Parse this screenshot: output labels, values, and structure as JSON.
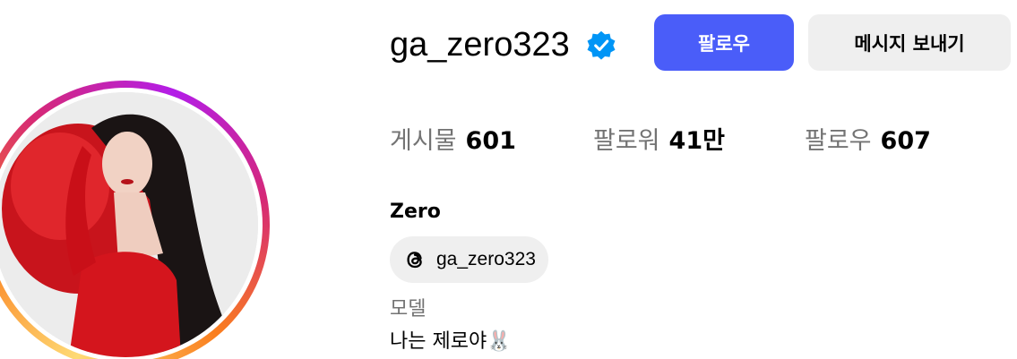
{
  "profile": {
    "username": "ga_zero323",
    "verified": true,
    "full_name": "Zero",
    "category": "모델",
    "bio": "나는 제로야🐰",
    "threads_handle": "ga_zero323"
  },
  "actions": {
    "follow_label": "팔로우",
    "message_label": "메시지 보내기"
  },
  "stats": {
    "posts_label": "게시물",
    "posts_value": "601",
    "followers_label": "팔로워",
    "followers_value": "41만",
    "following_label": "팔로우",
    "following_value": "607"
  },
  "colors": {
    "follow_button": "#4a5df9",
    "message_button": "#efefef",
    "verified_badge": "#0095f6",
    "muted_text": "#737373"
  },
  "icons": {
    "verified": "verified-badge-icon",
    "threads": "threads-icon"
  }
}
